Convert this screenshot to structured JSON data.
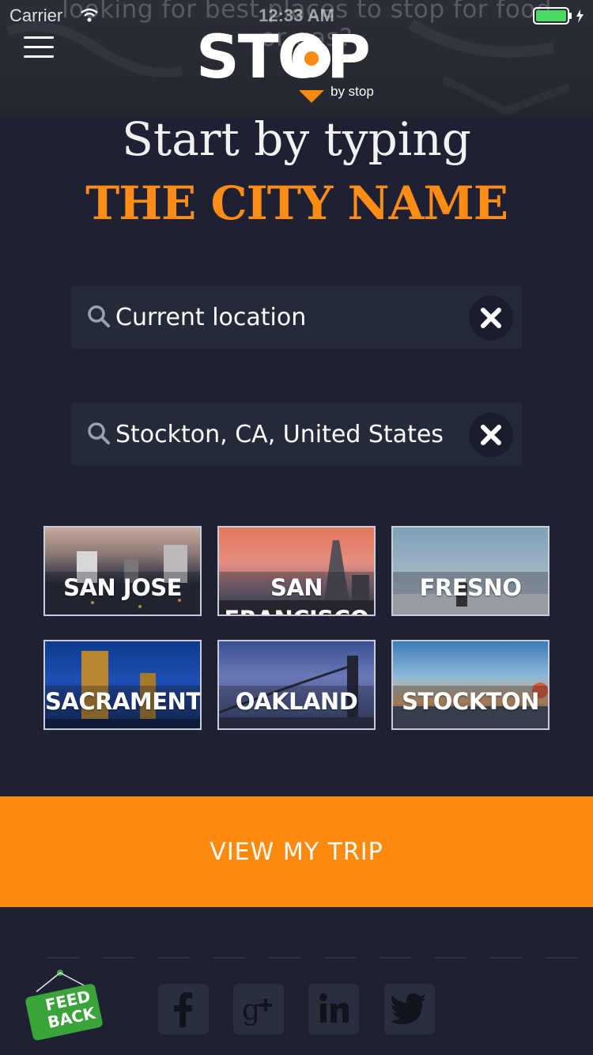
{
  "status_bar": {
    "carrier": "Carrier",
    "time": "12:33 AM"
  },
  "header": {
    "background_text": "looking for best places to stop for food or gas?",
    "logo": "STOP",
    "tagline": "by stop"
  },
  "headline": {
    "line1": "Start by typing",
    "line2": "THE CITY NAME"
  },
  "search": {
    "origin_value": "Current location",
    "destination_value": "Stockton, CA, United States"
  },
  "cities": [
    {
      "name": "SAN JOSE"
    },
    {
      "name": "SAN FRANCISCO"
    },
    {
      "name": "FRESNO"
    },
    {
      "name": "SACRAMENTO"
    },
    {
      "name": "OAKLAND"
    },
    {
      "name": "STOCKTON"
    }
  ],
  "trip_button": {
    "label": "VIEW MY TRIP"
  },
  "feedback": {
    "line1": "FEED",
    "line2": "BACK"
  },
  "social": [
    "facebook-icon",
    "google-plus-icon",
    "linkedin-icon",
    "twitter-icon"
  ],
  "colors": {
    "background": "#1d2133",
    "accent": "#fd8a0e",
    "feedback_green": "#3aa33a"
  }
}
